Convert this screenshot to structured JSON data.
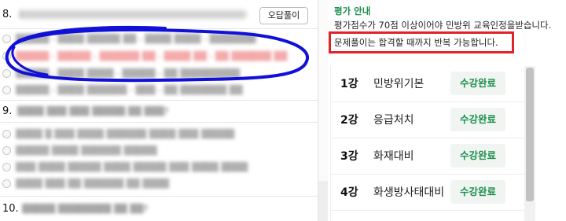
{
  "quiz": {
    "q8_num": "8.",
    "q8_text": "▒▒▒▒▒▒ ▒▒▒▒ ▒▒▒▒▒▒▒▒",
    "answer_button": "오답풀이",
    "q8_options": [
      "▒▒▒▒▒ - ▒▒▒▒ ▒▒▒▒▒ ▒▒ - ▒▒▒▒ ▒▒▒▒ - ▒▒▒▒▒▒▒",
      "▒▒▒▒▒ - ▒▒▒▒▒ - ▒▒▒▒▒▒ ▒▒ - ▒▒▒▒ ▒▒ - ▒▒ ▒▒▒▒▒▒ ▒▒",
      "▒▒▒▒▒ - ▒▒▒▒ ▒▒▒▒ - ▒▒▒▒▒ - ▒▒ ▒▒▒▒▒▒▒▒▒",
      "▒▒▒▒▒ - ▒▒▒▒ ▒▒▒▒▒▒ - ▒▒▒ - ▒▒ ▒▒▒▒▒▒▒ ▒▒"
    ],
    "q9_num": "9.",
    "q9_text": "▒▒▒▒ ▒▒▒ ▒▒▒ ▒▒▒▒▒ ▒▒ ▒▒▒?",
    "q9_options": [
      "▒▒▒▒ ▒ ▒▒▒ ▒▒▒▒ ▒▒▒▒▒▒ ▒▒▒▒ ▒▒▒ ▒▒▒▒▒",
      "▒▒▒▒▒ ▒▒▒▒ ▒▒▒▒▒▒ ▒▒▒▒▒",
      "▒▒▒ ▒▒▒▒ ▒▒▒▒▒ ▒▒▒▒ ▒▒▒▒▒ ▒▒▒ ▒▒▒▒ ▒▒▒▒",
      "▒▒▒▒ ▒▒▒ ▒▒ ▒▒▒▒▒▒ ▒▒ ▒▒▒▒"
    ],
    "q10_num": "10.",
    "q10_text": "▒▒▒▒▒ ▒▒▒▒▒▒▒▒ ▒▒ ▒▒?"
  },
  "notice": {
    "title": "평가 안내",
    "line1": "평가점수가 70점 이상이어야 민방위 교육인정을받습니다.",
    "line2": "문제풀이는 합격할 때까지 반복 가능합니다."
  },
  "courses": [
    {
      "num": "1강",
      "name": "민방위기본",
      "status": "수강완료"
    },
    {
      "num": "2강",
      "name": "응급처치",
      "status": "수강완료"
    },
    {
      "num": "3강",
      "name": "화재대비",
      "status": "수강완료"
    },
    {
      "num": "4강",
      "name": "화생방사태대비",
      "status": "수강완료"
    }
  ],
  "colors": {
    "accent_green": "#1a8f4c",
    "highlight_red": "#e0232a",
    "annotation_blue": "#1010d8"
  }
}
